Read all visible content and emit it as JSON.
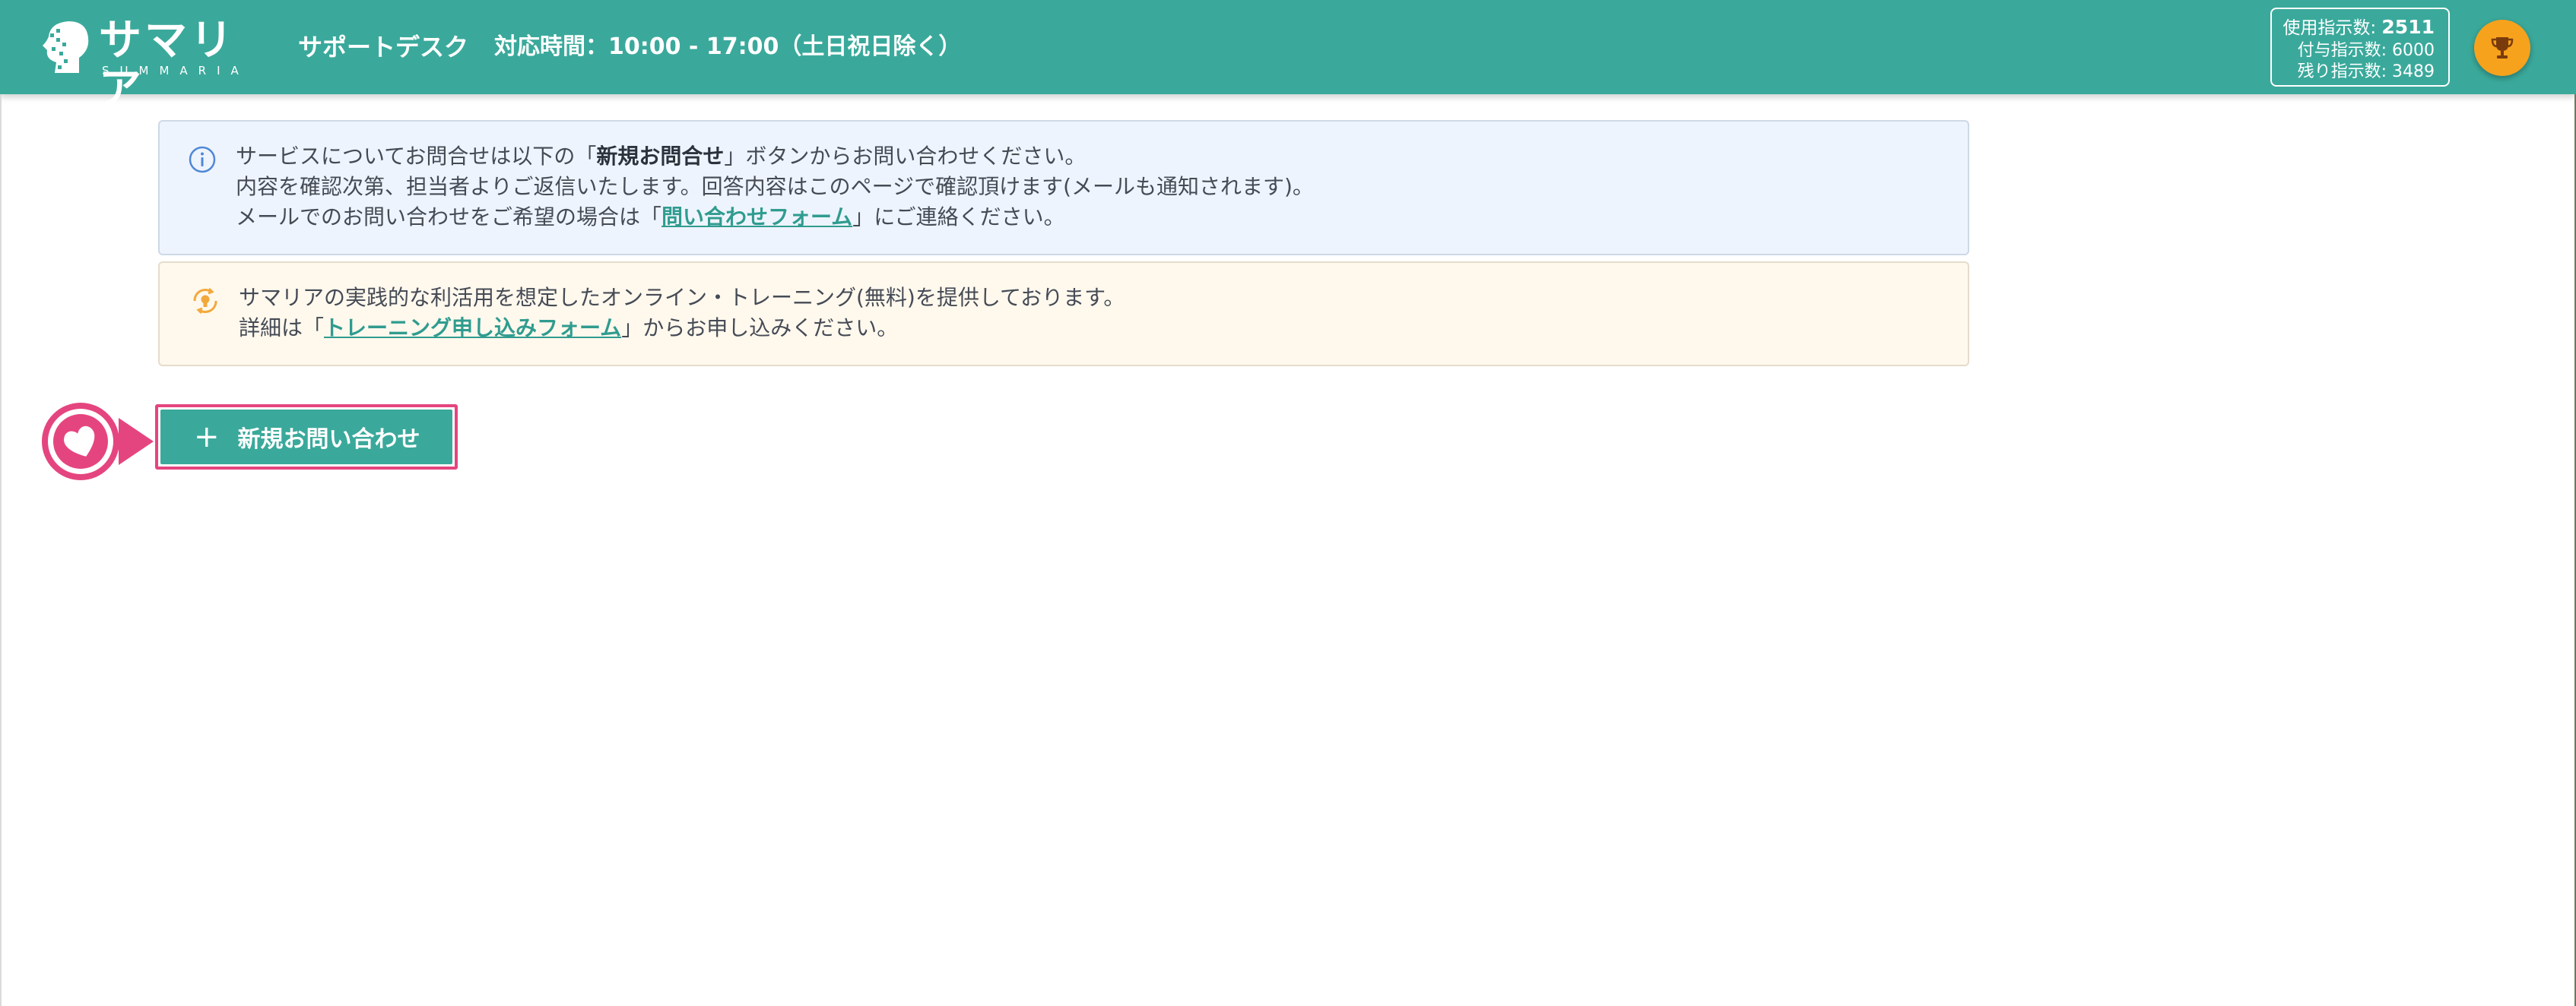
{
  "header": {
    "logo_text": "サマリア",
    "logo_sub": "SUMMARIA",
    "title": "サポートデスク",
    "hours": "対応時間：10:00 - 17:00（土日祝日除く）",
    "background_color": "#3aa99b"
  },
  "usage": {
    "used_label": "使用指示数:",
    "used_value": "2511",
    "granted_label": "付与指示数:",
    "granted_value": "6000",
    "remaining_label": "残り指示数:",
    "remaining_value": "3489"
  },
  "trophy": {
    "icon": "trophy-icon",
    "color": "#f7a21c"
  },
  "info": {
    "icon": "info-circle-icon",
    "line1_pre": "サービスについてお問合せは以下の「",
    "line1_bold": "新規お問合せ",
    "line1_post": "」ボタンからお問い合わせください。",
    "line2": "内容を確認次第、担当者よりご返信いたします。回答内容はこのページで確認頂けます(メールも通知されます)。",
    "line3_pre": "メールでのお問い合わせをご希望の場合は「",
    "line3_link": "問い合わせフォーム",
    "line3_post": "」にご連絡ください。"
  },
  "training": {
    "icon": "lightbulb-icon",
    "line1": "サマリアの実践的な利活用を想定したオンライン・トレーニング(無料)を提供しております。",
    "line2_pre": "詳細は「",
    "line2_link": "トレーニング申し込みフォーム",
    "line2_post": "」からお申し込みください。"
  },
  "new_inquiry": {
    "icon": "plus-icon",
    "plus": "+",
    "label": "新規お問い合わせ",
    "accent": "#e5457f"
  }
}
